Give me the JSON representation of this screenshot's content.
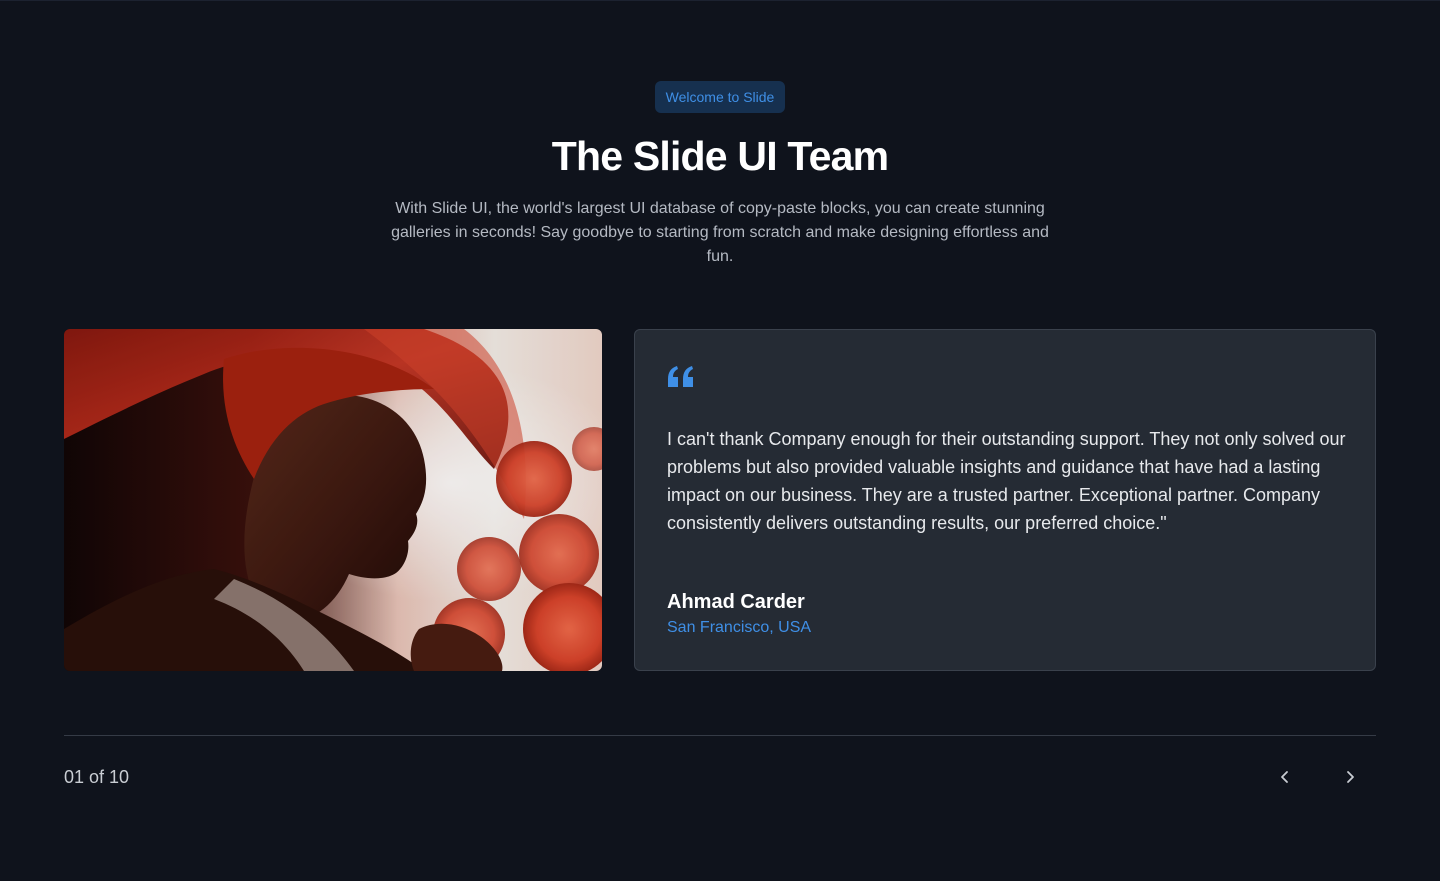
{
  "header": {
    "badge": "Welcome to Slide",
    "title": "The Slide UI Team",
    "subtitle": "With Slide UI, the world's largest UI database of copy-paste blocks, you can create stunning galleries in seconds! Say goodbye to starting from scratch and make designing effortless and fun."
  },
  "testimonial": {
    "photo_icon": "portrait-photo",
    "quote_icon": "quote-icon",
    "quote": "I can't thank Company enough for their outstanding support. They not only solved our problems but also provided valuable insights and guidance that have had a lasting impact on our business. They are a trusted partner. Exceptional partner. Company consistently delivers outstanding results, our preferred choice.\"",
    "author_name": "Ahmad Carder",
    "author_location": "San Francisco, USA"
  },
  "pagination": {
    "counter": "01 of 10",
    "prev_icon": "chevron-left-icon",
    "next_icon": "chevron-right-icon"
  },
  "colors": {
    "background": "#0f131c",
    "card": "#252b34",
    "accent": "#3f8fe6",
    "badge_bg": "#16304f"
  }
}
